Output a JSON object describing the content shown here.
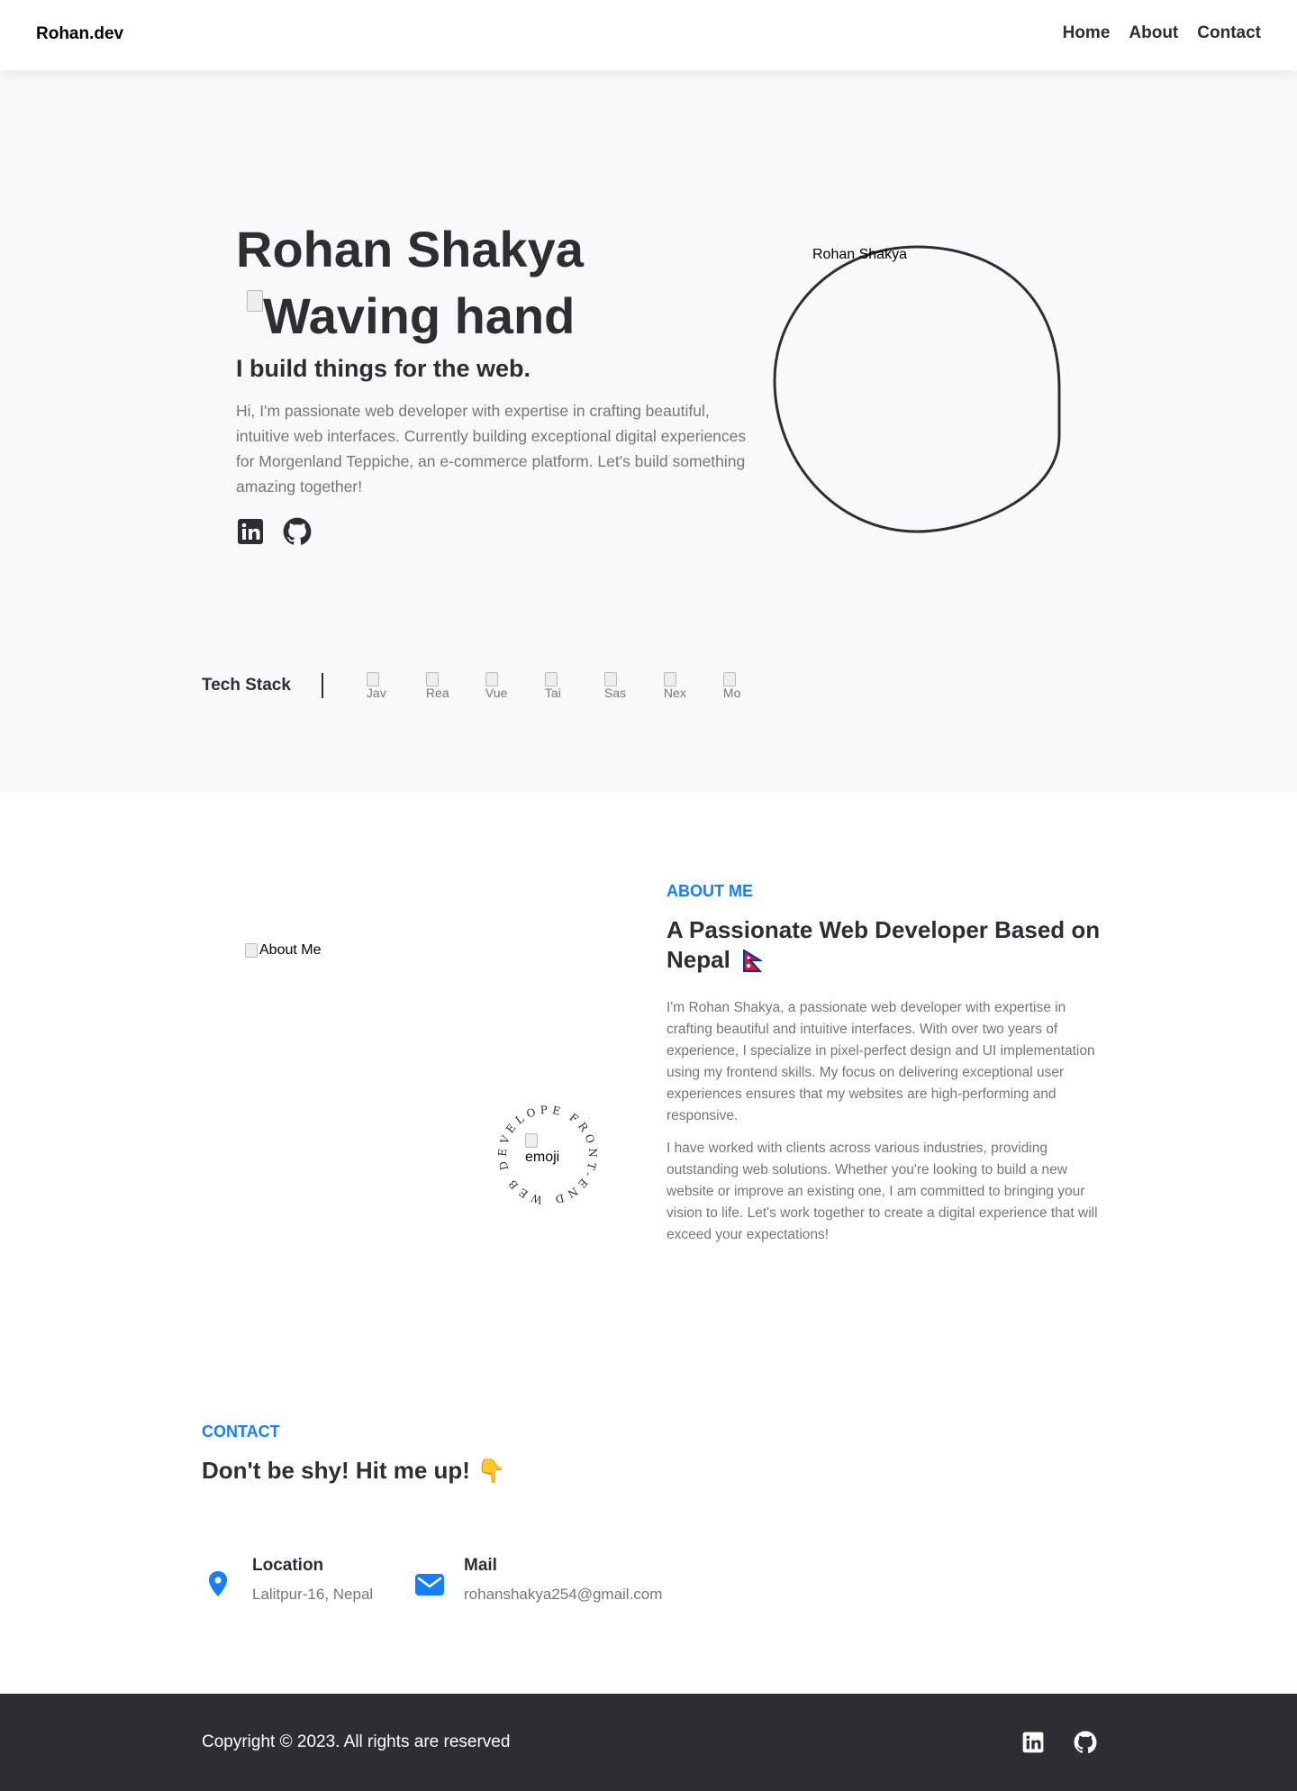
{
  "header": {
    "logo": "Rohan.dev",
    "nav": [
      "Home",
      "About",
      "Contact"
    ]
  },
  "hero": {
    "name": "Rohan Shakya",
    "wave_alt": "Waving hand",
    "tagline": "I build things for the web.",
    "description": "Hi, I'm passionate web developer with expertise in crafting beautiful, intuitive web interfaces. Currently building exceptional digital experiences for Morgenland Teppiche, an e-commerce platform. Let's build something amazing together!",
    "profile_alt": "Rohan Shakya",
    "social_icons": [
      "linkedin-icon",
      "github-icon"
    ]
  },
  "tech_stack": {
    "label": "Tech Stack",
    "icons": [
      "Jav",
      "Rea",
      "Vue",
      "Tai",
      "Sas",
      "Nex",
      "Mo"
    ]
  },
  "about": {
    "image_alt": "About Me",
    "badge_text": "FRONT-END WEB DEVELOPER",
    "emoji_alt": "emoji",
    "eyebrow": "ABOUT ME",
    "title": "A Passionate Web Developer Based on Nepal",
    "p1": "I'm Rohan Shakya, a passionate web developer with expertise in crafting beautiful and intuitive interfaces. With over two years of experience, I specialize in pixel-perfect design and UI implementation using my frontend skills. My focus on delivering exceptional user experiences ensures that my websites are high-performing and responsive.",
    "p2": "I have worked with clients across various industries, providing outstanding web solutions. Whether you're looking to build a new website or improve an existing one, I am committed to bringing your vision to life. Let's work together to create a digital experience that will exceed your expectations!"
  },
  "contact": {
    "eyebrow": "CONTACT",
    "title": "Don't be shy! Hit me up! 👇",
    "location_heading": "Location",
    "location_value": "Lalitpur-16, Nepal",
    "mail_heading": "Mail",
    "mail_value": "rohanshakya254@gmail.com"
  },
  "footer": {
    "copyright": "Copyright © 2023. All rights are reserved"
  },
  "colors": {
    "accent": "#147efb",
    "dark": "#2d2e32",
    "muted": "#767676",
    "hero_bg": "#f9f9f9"
  }
}
